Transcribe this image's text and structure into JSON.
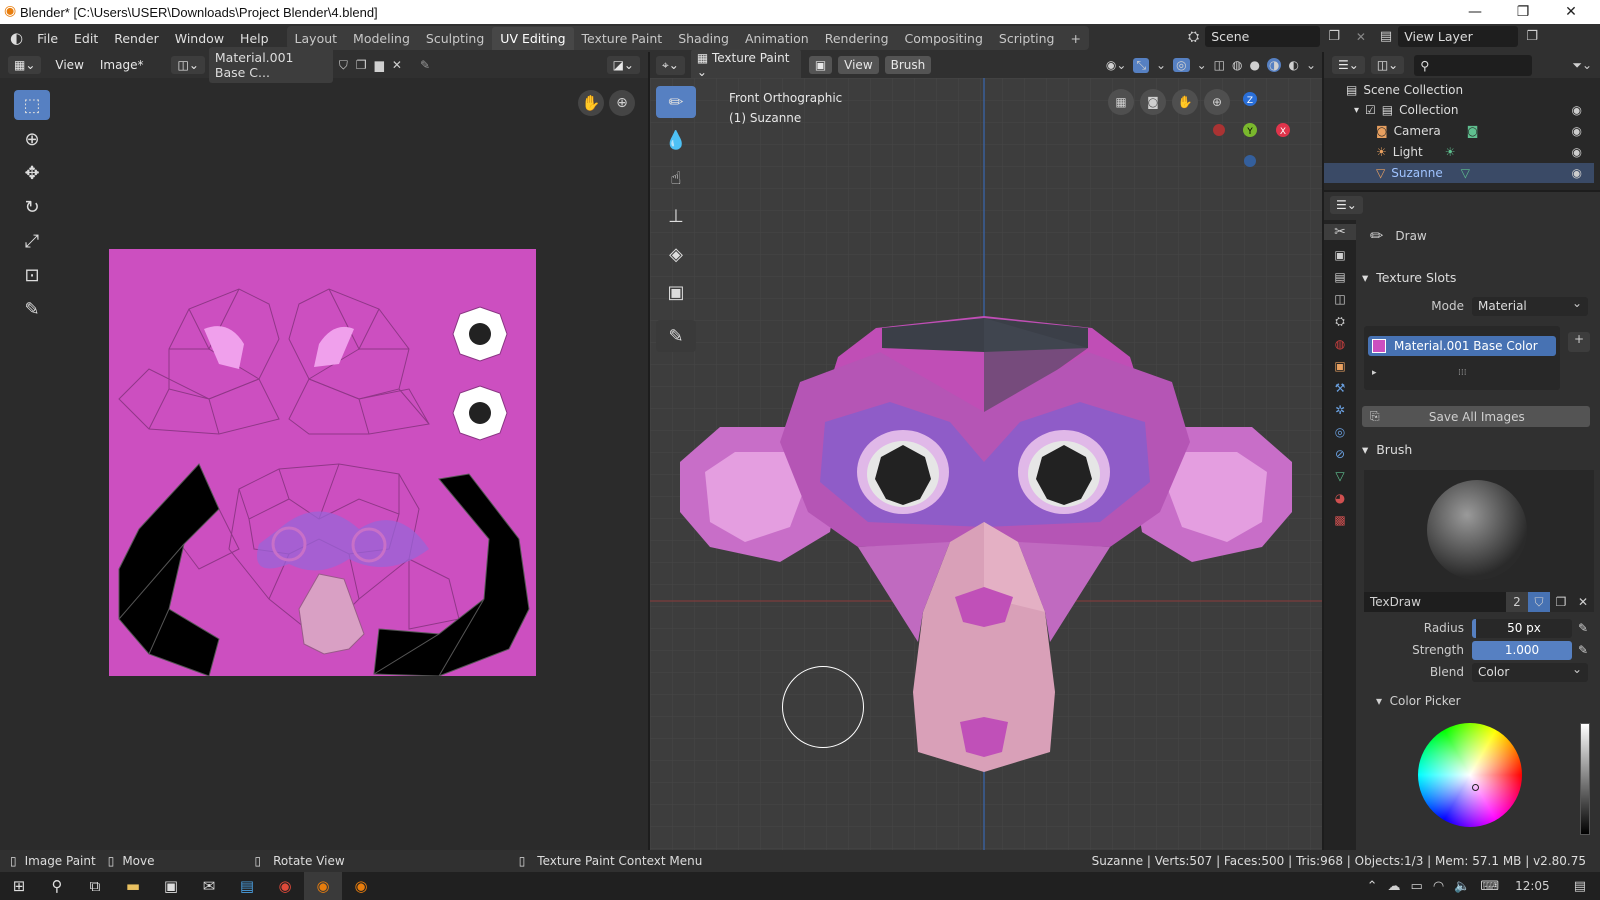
{
  "window": {
    "title": "Blender* [C:\\Users\\USER\\Downloads\\Project Blender\\4.blend]",
    "minimize": "—",
    "maximize": "❐",
    "close": "✕"
  },
  "menu": [
    "File",
    "Edit",
    "Render",
    "Window",
    "Help"
  ],
  "workspaces": [
    "Layout",
    "Modeling",
    "Sculpting",
    "UV Editing",
    "Texture Paint",
    "Shading",
    "Animation",
    "Rendering",
    "Compositing",
    "Scripting",
    "+"
  ],
  "active_workspace": "UV Editing",
  "scene": {
    "label": "Scene",
    "view_layer": "View Layer"
  },
  "image_editor": {
    "view": "View",
    "image": "Image*",
    "image_name": "Material.001 Base C..."
  },
  "viewport": {
    "mode": "Texture Paint",
    "view": "View",
    "brush": "Brush",
    "overlay_title": "Front Orthographic",
    "overlay_object": "(1) Suzanne",
    "gizmo": {
      "z": "Z",
      "y": "Y",
      "x": "X"
    }
  },
  "outliner": {
    "root": "Scene Collection",
    "collection": "Collection",
    "items": [
      "Camera",
      "Light",
      "Suzanne"
    ]
  },
  "properties": {
    "tool_name": "Draw",
    "texture_slots": "Texture Slots",
    "mode_label": "Mode",
    "mode_value": "Material",
    "slot": "Material.001 Base Color",
    "save_all": "Save All Images",
    "brush_section": "Brush",
    "brush_name": "TexDraw",
    "brush_users": "2",
    "radius_label": "Radius",
    "radius_value": "50 px",
    "strength_label": "Strength",
    "strength_value": "1.000",
    "blend_label": "Blend",
    "blend_value": "Color",
    "color_picker": "Color Picker"
  },
  "status": {
    "left1": "Image Paint",
    "left2": "Move",
    "left3": "Rotate View",
    "center": "Texture Paint Context Menu",
    "right": "Suzanne | Verts:507 | Faces:500 | Tris:968 | Objects:1/3 | Mem: 57.1 MB | v2.80.75"
  },
  "taskbar": {
    "time": "12:05"
  },
  "colors": {
    "accent": "#5680c2",
    "texture_bg": "#cc4fc0",
    "monkey_pink": "#c86ec8"
  }
}
